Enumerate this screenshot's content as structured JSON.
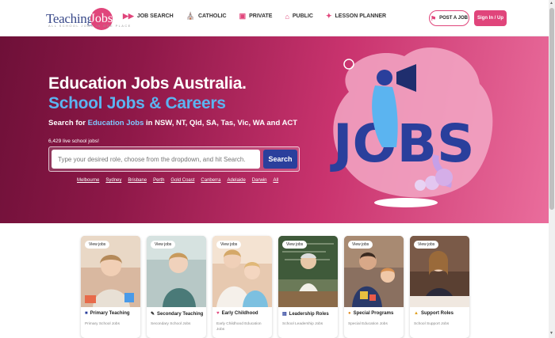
{
  "header": {
    "logo_main": "Teaching",
    "logo_circle": "Jobs",
    "logo_sub": "ALL SCHOOL JOBS IN ONE PLACE",
    "nav": [
      {
        "label": "JOB SEARCH",
        "icon": "search-arrows-icon"
      },
      {
        "label": "CATHOLIC",
        "icon": "church-icon"
      },
      {
        "label": "PRIVATE",
        "icon": "building-icon"
      },
      {
        "label": "PUBLIC",
        "icon": "school-icon"
      },
      {
        "label": "LESSON PLANNER",
        "icon": "planner-icon"
      }
    ],
    "post_job": "POST A JOB",
    "sign_in": "Sign In / Up"
  },
  "hero": {
    "title_line1": "Education Jobs Australia.",
    "title_line2": "School Jobs & Careers",
    "sub_prefix": "Search for ",
    "sub_highlight": "Education Jobs",
    "sub_suffix": " in NSW, NT, Qld, SA, Tas, Vic, WA and ACT",
    "live_count": "6,429 live school jobs!",
    "search_placeholder": "Type your desired role, choose from the dropdown, and hit Search.",
    "search_button": "Search",
    "cities": [
      "Melbourne",
      "Sydney",
      "Brisbane",
      "Perth",
      "Gold Coast",
      "Canberra",
      "Adelaide",
      "Darwin",
      "All"
    ],
    "illustration_text": "JOBS"
  },
  "cards": [
    {
      "tag": "View jobs",
      "title": "Primary Teaching",
      "icon": "book-icon",
      "desc": "Primary School Jobs",
      "img_color": "#d9b8a0"
    },
    {
      "tag": "View jobs",
      "title": "Secondary Teaching",
      "icon": "pen-icon",
      "desc": "Secondary School Jobs",
      "img_color": "#b7c8c6"
    },
    {
      "tag": "View jobs",
      "title": "Early Childhood",
      "icon": "heart-icon",
      "desc": "Early Childhood Education Jobs",
      "img_color": "#e7c9b0"
    },
    {
      "tag": "View jobs",
      "title": "Leadership Roles",
      "icon": "chart-icon",
      "desc": "School Leadership Jobs",
      "img_color": "#7b8c6a"
    },
    {
      "tag": "View jobs",
      "title": "Special Programs",
      "icon": "globe-icon",
      "desc": "Special Education Jobs",
      "img_color": "#8a7060"
    },
    {
      "tag": "View jobs",
      "title": "Support Roles",
      "icon": "person-icon",
      "desc": "School Support Jobs",
      "img_color": "#6a5040"
    }
  ],
  "colors": {
    "brand_pink": "#e0457b",
    "brand_navy": "#2a3f9c",
    "hero_blue_text": "#5bb4f0"
  }
}
